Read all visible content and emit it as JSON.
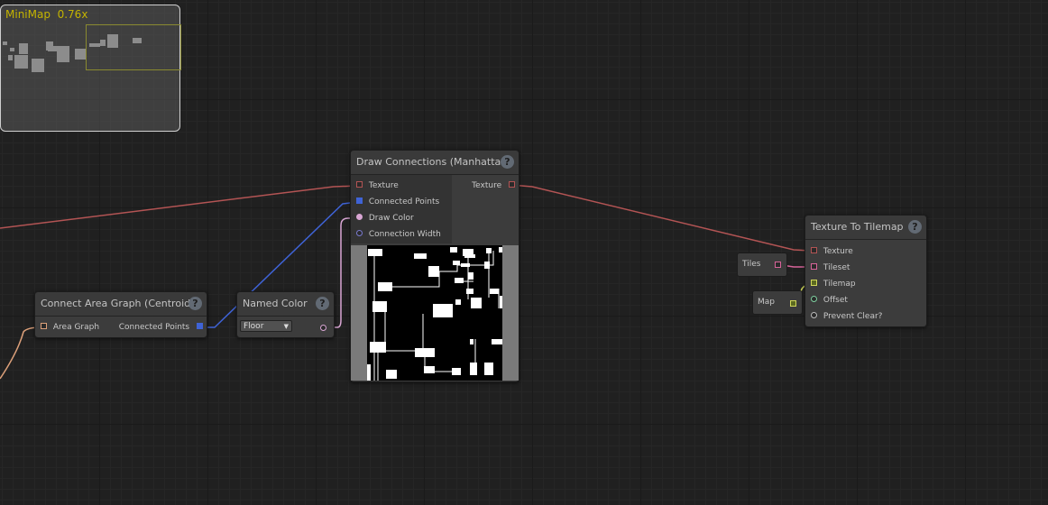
{
  "minimap": {
    "title": "MiniMap",
    "zoom": "0.76x"
  },
  "nodes": {
    "connect_area_graph": {
      "title": "Connect Area Graph (Centroids)",
      "input_label": "Area Graph",
      "output_label": "Connected Points"
    },
    "named_color": {
      "title": "Named Color",
      "dropdown_value": "Floor",
      "dropdown_icon": "chevron-down-icon"
    },
    "draw_connections": {
      "title": "Draw Connections (Manhattan)",
      "inputs": [
        "Texture",
        "Connected Points",
        "Draw Color",
        "Connection Width"
      ],
      "output_label": "Texture"
    },
    "texture_to_tilemap": {
      "title": "Texture To Tilemap",
      "inputs": [
        "Texture",
        "Tileset",
        "Tilemap",
        "Offset",
        "Prevent Clear?"
      ]
    },
    "tiles": {
      "label": "Tiles"
    },
    "map": {
      "label": "Map"
    }
  },
  "help_glyph": "?",
  "colors": {
    "texture_wire": "#b35454",
    "points_wire": "#3f63d6",
    "color_wire": "#d9a6d4",
    "area_wire": "#dca07a",
    "tilemap_wire": "#cfd65a",
    "tileset_wire": "#d8649a"
  }
}
